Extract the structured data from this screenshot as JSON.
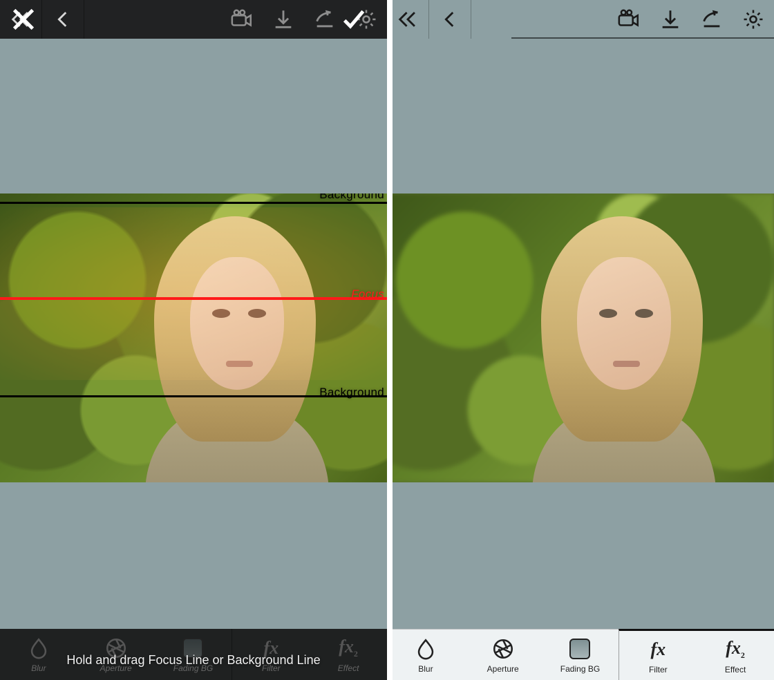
{
  "left": {
    "overlay": {
      "cancel": "close",
      "confirm": "check"
    },
    "focus_lines": {
      "background_label": "Background",
      "focus_label": "Focus"
    },
    "toast": "Hold and drag Focus Line or Background Line",
    "bottom": [
      {
        "id": "blur",
        "label": "Blur"
      },
      {
        "id": "aperture",
        "label": "Aperture"
      },
      {
        "id": "fadingbg",
        "label": "Fading BG"
      },
      {
        "id": "filter",
        "label": "Filter"
      },
      {
        "id": "effect",
        "label": "Effect"
      }
    ]
  },
  "right": {
    "top_icons": [
      "rewind",
      "back",
      "camera",
      "download",
      "share",
      "settings"
    ],
    "bottom": [
      {
        "id": "blur",
        "label": "Blur"
      },
      {
        "id": "aperture",
        "label": "Aperture"
      },
      {
        "id": "fadingbg",
        "label": "Fading BG"
      },
      {
        "id": "filter",
        "label": "Filter"
      },
      {
        "id": "effect",
        "label": "Effect"
      }
    ]
  },
  "colors": {
    "canvas_bg": "#8da0a3",
    "focus_line": "#ff1a1a",
    "background_line": "#000000"
  }
}
